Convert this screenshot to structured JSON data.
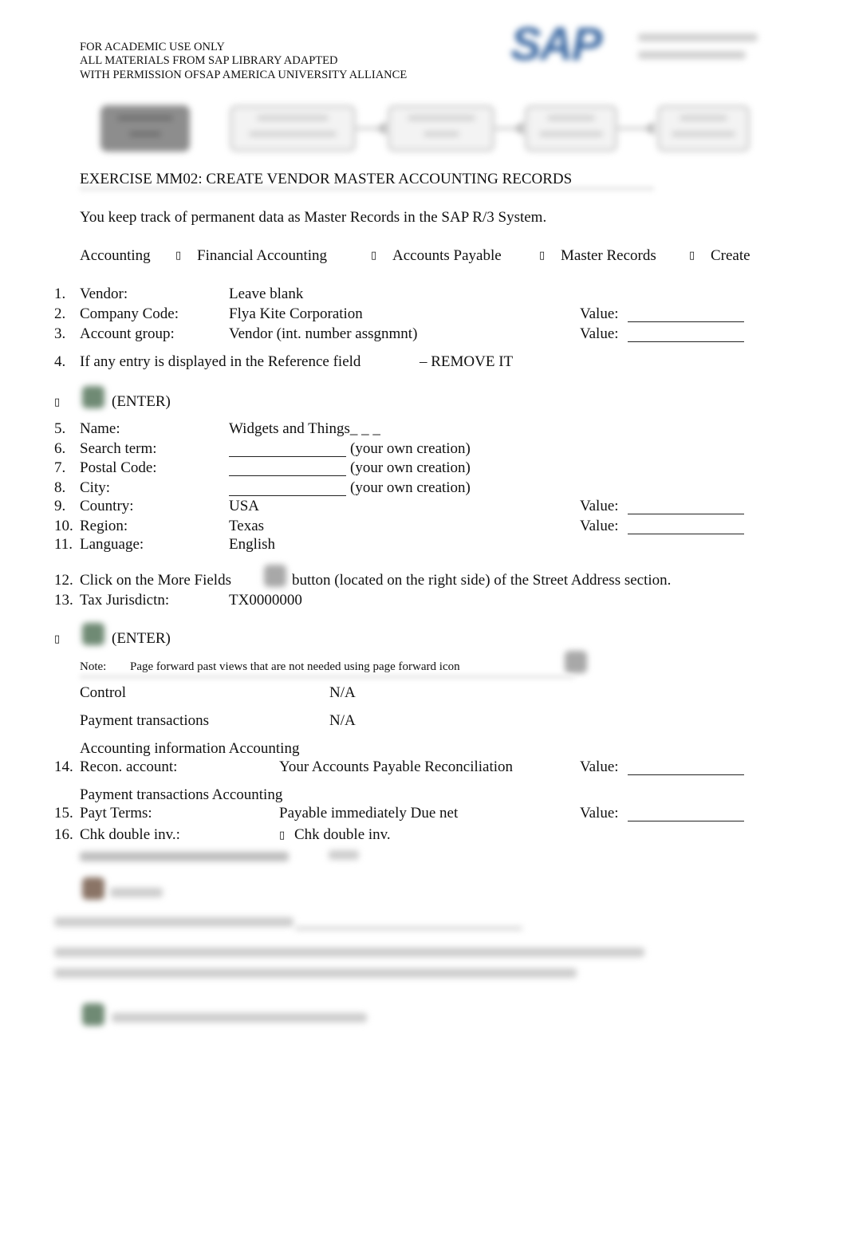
{
  "header": {
    "lines": [
      "FOR ACADEMIC USE ONLY",
      "ALL MATERIALS FROM SAP LIBRARY ADAPTED",
      "WITH PERMISSION OFSAP AMERICA UNIVERSITY ALLIANCE"
    ],
    "logo": "SAP",
    "brand_color": "#3d6aa3"
  },
  "title": "EXERCISE MM02: CREATE VENDOR MASTER ACCOUNTING RECORDS",
  "intro": "You keep track of permanent data as Master Records in the SAP R/3 System.",
  "menu_path": {
    "items": [
      "Accounting",
      "Financial Accounting",
      "Accounts Payable",
      "Master Records",
      "Create"
    ],
    "separator_icon": "arrow-right-icon",
    "separator_glyph": "▯"
  },
  "steps_a": [
    {
      "num": "1.",
      "label": "Vendor:",
      "value": "Leave blank",
      "has_value_blank": false
    },
    {
      "num": "2.",
      "label": "Company Code:",
      "value": "Flya Kite Corporation",
      "has_value_blank": true
    },
    {
      "num": "3.",
      "label": "Account group:",
      "value": "Vendor (int. number assgnmnt)",
      "has_value_blank": true
    }
  ],
  "step4": {
    "num": "4.",
    "text": "If any entry is displayed in the Reference field",
    "action": "– REMOVE IT"
  },
  "enter_label": "(ENTER)",
  "bullet_glyph": "▯",
  "steps_b": [
    {
      "num": "5.",
      "label": "Name:",
      "value": "Widgets and Things_ _ _"
    },
    {
      "num": "6.",
      "label": "Search term:",
      "value": "(your own creation)",
      "blank": true
    },
    {
      "num": "7.",
      "label": "Postal Code:",
      "value": "(your own creation)",
      "blank": true
    },
    {
      "num": "8.",
      "label": "City:",
      "value": "(your own creation)",
      "blank": true
    },
    {
      "num": "9.",
      "label": "Country:",
      "value": "USA",
      "has_value_blank": true
    },
    {
      "num": "10.",
      "label": "Region:",
      "value": "Texas",
      "has_value_blank": true
    },
    {
      "num": "11.",
      "label": "Language:",
      "value": "English"
    }
  ],
  "step12": {
    "num": "12.",
    "before": "Click on the More Fields",
    "after": "button (located on the right side) of the Street Address section."
  },
  "step13": {
    "num": "13.",
    "label": "Tax Jurisdictn:",
    "value": "TX0000000"
  },
  "note": {
    "label": "Note:",
    "text": "Page forward past views that are not needed using page forward icon"
  },
  "views": [
    {
      "label": "Control",
      "value": "N/A"
    },
    {
      "label": "Payment transactions",
      "value": "N/A"
    }
  ],
  "section_accounting": "Accounting information Accounting",
  "step14": {
    "num": "14.",
    "label": "Recon. account:",
    "value": "Your Accounts Payable Reconciliation"
  },
  "section_payment": "Payment transactions Accounting",
  "step15": {
    "num": "15.",
    "label": "Payt Terms:",
    "value": "Payable immediately Due net"
  },
  "step16": {
    "num": "16.",
    "label": "Chk double inv.:",
    "checkbox_glyph": "▯",
    "value": "Chk double inv."
  },
  "value_label": "Value:"
}
